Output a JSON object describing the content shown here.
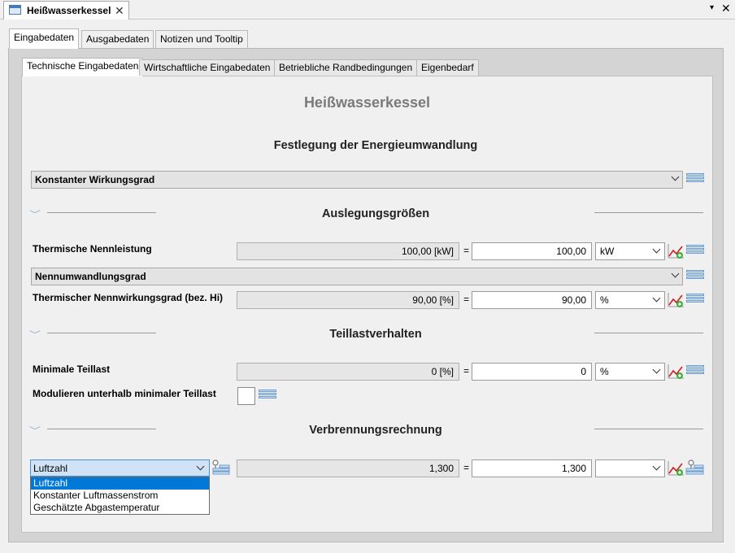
{
  "window": {
    "tab_title": "Heißwasserkessel",
    "close_glyph": "✕",
    "menu_glyph": "▾",
    "close_window_glyph": "✕"
  },
  "outer_tabs": [
    "Eingabedaten",
    "Ausgabedaten",
    "Notizen und Tooltip"
  ],
  "inner_tabs": [
    "Technische Eingabedaten",
    "Wirtschaftliche Eingabedaten",
    "Betriebliche Randbedingungen",
    "Eigenbedarf"
  ],
  "page_title": "Heißwasserkessel",
  "energy": {
    "section_title": "Festlegung der Energieumwandlung",
    "mode_value": "Konstanter Wirkungsgrad"
  },
  "design": {
    "section_title": "Auslegungsgrößen",
    "nominal_power": {
      "label": "Thermische Nennleistung",
      "readonly": "100,00 [kW]",
      "value": "100,00",
      "unit": "kW"
    },
    "conversion_mode": "Nennumwandlungsgrad",
    "efficiency": {
      "label": "Thermischer Nennwirkungsgrad (bez. Hi)",
      "readonly": "90,00 [%]",
      "value": "90,00",
      "unit": "%"
    }
  },
  "partload": {
    "section_title": "Teillastverhalten",
    "min_partload": {
      "label": "Minimale Teillast",
      "readonly": "0 [%]",
      "value": "0",
      "unit": "%"
    },
    "modulate_label": "Modulieren unterhalb minimaler Teillast"
  },
  "combustion": {
    "section_title": "Verbrennungsrechnung",
    "selected": "Luftzahl",
    "options": [
      "Luftzahl",
      "Konstanter Luftmassenstrom",
      "Geschätzte Abgastemperatur"
    ],
    "readonly": "1,300",
    "value": "1,300",
    "unit": ""
  },
  "equals_sign": "="
}
